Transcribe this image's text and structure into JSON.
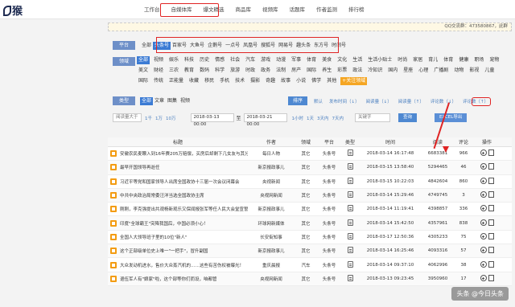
{
  "logo": {
    "text": "猴"
  },
  "nav": [
    "工作台",
    "自媒体库",
    "爆文精选",
    "商品库",
    "视频库",
    "话题库",
    "作者监测",
    "排行榜"
  ],
  "qq": "QQ交流群：473580867，此群",
  "platform": {
    "label": "平台",
    "items": [
      "全部",
      "头条号",
      "百家号",
      "大鱼号",
      "企鹅号",
      "一点号",
      "凤凰号",
      "搜狐号",
      "网易号",
      "趣头条",
      "东方号",
      "时间号"
    ],
    "selected": "头条号"
  },
  "category": {
    "label": "领域",
    "items": [
      "全部",
      "视频",
      "娱乐",
      "科技",
      "历史",
      "情感",
      "社会",
      "汽车",
      "游戏",
      "动漫",
      "军事",
      "体育",
      "美食",
      "文化",
      "生活",
      "生活小贴士",
      "时尚",
      "家居",
      "育儿",
      "体育",
      "健康",
      "职场",
      "宠物",
      "美文",
      "财经",
      "三农",
      "教育",
      "数码",
      "科学",
      "旅游",
      "时政",
      "政务",
      "法制",
      "房产",
      "国际",
      "养生",
      "彩票",
      "政法",
      "冷知识",
      "国内",
      "星座",
      "心理",
      "广播剧",
      "动物",
      "影视",
      "儿童",
      "国际",
      "传统",
      "正能量",
      "收藏",
      "移民",
      "手机",
      "技术",
      "摄影",
      "奇趣",
      "故事",
      "小说",
      "佛学",
      "其他"
    ],
    "follow_btn": "+关注领域"
  },
  "type": {
    "label": "类型",
    "items": [
      "全部",
      "文章",
      "图集",
      "视频"
    ]
  },
  "sort": {
    "btn": "排序",
    "items": [
      "默认",
      "发布时间（↓）",
      "阅读量（↓）",
      "阅读量（↑）",
      "评论数（↓）",
      "评论数（↑）"
    ]
  },
  "filter": {
    "read_placeholder": "阅读量大于",
    "read_opts": [
      "1千",
      "1万",
      "10万"
    ],
    "date_from": "2018-03-13 00:00",
    "to": "至",
    "date_to": "2018-03-21 00:00",
    "date_links": [
      "1小时",
      "1天",
      "3天内",
      "7天内"
    ],
    "keyword_placeholder": "关键字",
    "search_btn": "查询",
    "export_btn": "EXCEL导出"
  },
  "table": {
    "headers": [
      "标题",
      "作者",
      "领域",
      "平台",
      "类型",
      "时间",
      "阅读",
      "评论",
      "操作"
    ],
    "rows": [
      {
        "title": "安徽农民麦瞟入到16年赛205万赔偿，买房后却剩下几女友与其分手",
        "author": "每日人物",
        "field": "其它",
        "platform": "头条号",
        "time": "2018-03-14 16:17:48",
        "read": "6683381",
        "cmt": "966"
      },
      {
        "title": "最早开国领导再逝任",
        "author": "新京报政事儿",
        "field": "其它",
        "platform": "头条号",
        "time": "2018-03-15 13:58:40",
        "read": "5294465",
        "cmt": "46"
      },
      {
        "title": "习近平等党和国家领导人出席全国政协十三届一次会议闭幕会",
        "author": "央视新闻",
        "field": "其它",
        "platform": "头条号",
        "time": "2018-03-15 10:22:03",
        "read": "4842604",
        "cmt": "860"
      },
      {
        "title": "中共中央政治局常委汪洋当选全国政协主席",
        "author": "央视网新闻",
        "field": "其它",
        "platform": "头条号",
        "time": "2018-03-14 15:29:46",
        "read": "4749745",
        "cmt": "3"
      },
      {
        "title": "刚刚，李克强提出共观杨新观乐又保闻报张军等任人民大会堂宣誓",
        "author": "新京报政事儿",
        "field": "其它",
        "platform": "头条号",
        "time": "2018-03-14 11:19:41",
        "read": "4398857",
        "cmt": "336"
      },
      {
        "title": "印度\"全球霸王\"突降我国后，中国必须小心！",
        "author": "环球网新媒体",
        "field": "其它",
        "platform": "头条号",
        "time": "2018-03-14 15:42:50",
        "read": "4357961",
        "cmt": "838"
      },
      {
        "title": "全国人大领导班子里的10位\"新人\"",
        "author": "长安街知事",
        "field": "其它",
        "platform": "头条号",
        "time": "2018-03-17 12:50:36",
        "read": "4305233",
        "cmt": "75"
      },
      {
        "title": "这个正部级单位史上唯一\"一把手\"，冒升副国",
        "author": "新京报政事儿",
        "field": "其它",
        "platform": "头条号",
        "time": "2018-03-14 16:25:46",
        "read": "4093316",
        "cmt": "57"
      },
      {
        "title": "大众发动机进水，售价大众蒸汽机的……这些有苦伤权被曝光！",
        "author": "重庆晨报",
        "field": "汽车",
        "platform": "头条号",
        "time": "2018-03-14 09:37:10",
        "read": "4062996",
        "cmt": "38"
      },
      {
        "title": "退伍军人有\"娘家\"啦，这个部等你们而设，咱都管",
        "author": "央视网新闻",
        "field": "其它",
        "platform": "头条号",
        "time": "2018-03-13 09:23:45",
        "read": "3950960",
        "cmt": "17"
      }
    ]
  },
  "watermark": "头条 @今日头条"
}
